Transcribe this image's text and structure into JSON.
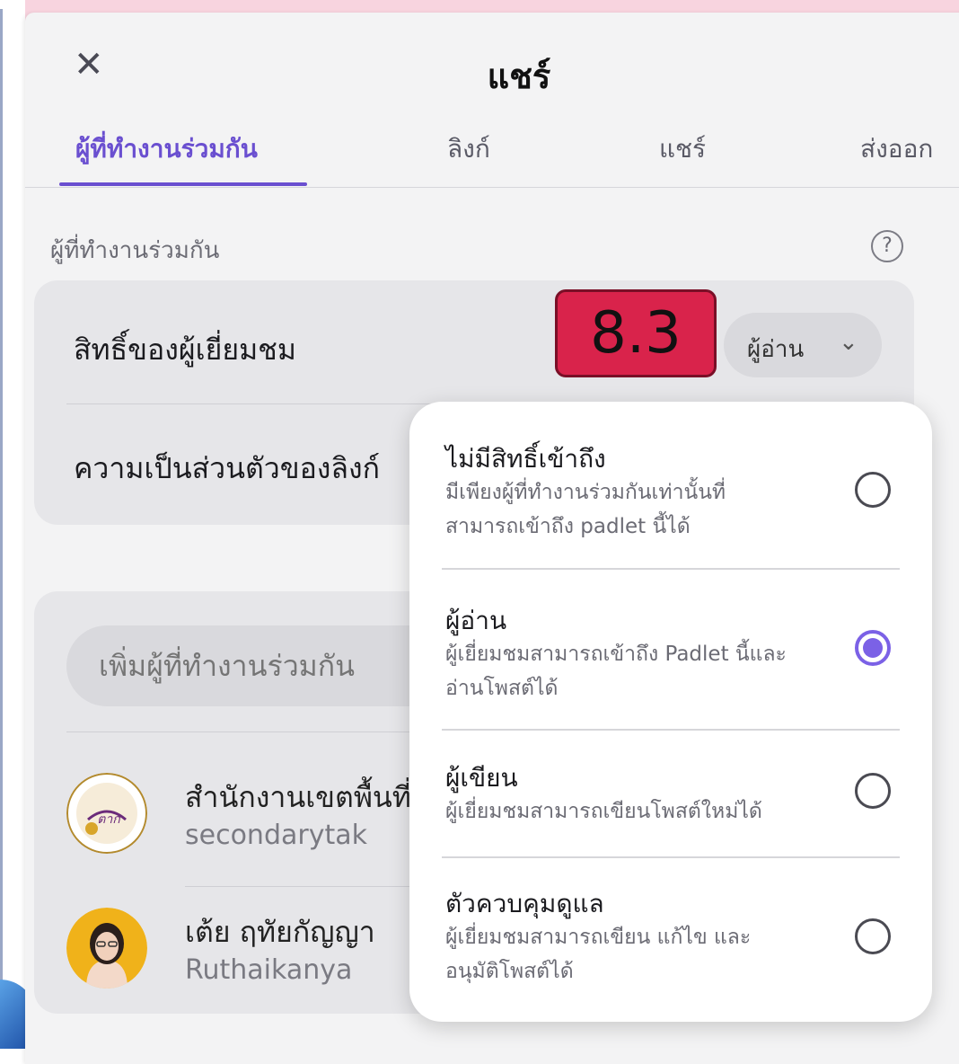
{
  "panel": {
    "title": "แชร์"
  },
  "tabs": [
    {
      "label": "ผู้ที่ทำงานร่วมกัน",
      "active": true
    },
    {
      "label": "ลิงก์"
    },
    {
      "label": "แชร์"
    },
    {
      "label": "ส่งออก"
    }
  ],
  "collaborators_section": {
    "label": "ผู้ที่ทำงานร่วมกัน",
    "visitor_permission_label": "สิทธิ์ของผู้เยี่ยมชม",
    "link_privacy_label": "ความเป็นส่วนตัวของลิงก์",
    "role_button": "ผู้อ่าน"
  },
  "badge": "8.3",
  "add_collaborator": {
    "placeholder": "เพิ่มผู้ที่ทำงานร่วมกัน"
  },
  "collaborators": [
    {
      "name": "สำนักงานเขตพื้นที่การศึกษามัธยมศึกษาตาก",
      "handle": "secondarytak",
      "avatar_text": "ตาก"
    },
    {
      "name": "เต้ย ฤทัยกัญญา",
      "handle": "Ruthaikanya"
    }
  ],
  "role_options": [
    {
      "title": "ไม่มีสิทธิ์เข้าถึง",
      "desc": "มีเพียงผู้ที่ทำงานร่วมกันเท่านั้นที่สามารถเข้าถึง padlet นี้ได้",
      "selected": false
    },
    {
      "title": "ผู้อ่าน",
      "desc": "ผู้เยี่ยมชมสามารถเข้าถึง Padlet นี้และอ่านโพสต์ได้",
      "selected": true
    },
    {
      "title": "ผู้เขียน",
      "desc": "ผู้เยี่ยมชมสามารถเขียนโพสต์ใหม่ได้",
      "selected": false
    },
    {
      "title": "ตัวควบคุมดูแล",
      "desc": "ผู้เยี่ยมชมสามารถเขียน แก้ไข และอนุมัติโพสต์ได้",
      "selected": false
    }
  ],
  "colors": {
    "accent": "#6a4fd0",
    "radio_selected": "#7b61e6",
    "badge": "#d9234b"
  },
  "icons": {
    "close": "close-icon",
    "help": "help-icon",
    "chevron": "chevron-down-icon"
  }
}
